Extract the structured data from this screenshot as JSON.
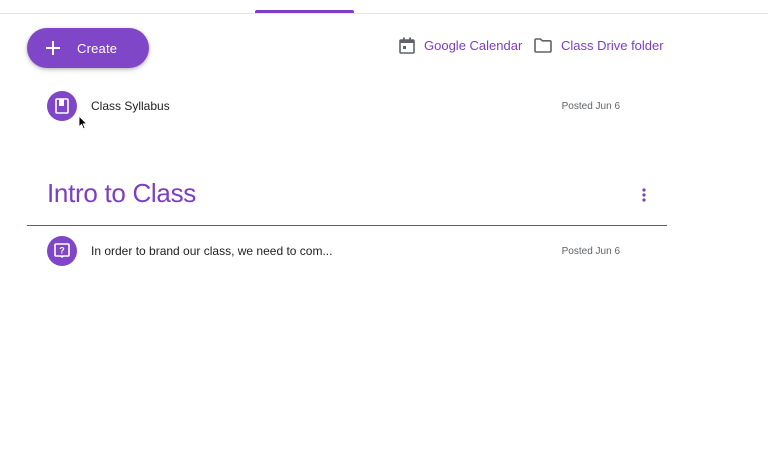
{
  "header": {
    "create_label": "Create",
    "calendar_label": "Google Calendar",
    "drive_label": "Class Drive folder"
  },
  "items": {
    "syllabus": {
      "title": "Class Syllabus",
      "posted": "Posted Jun 6",
      "icon": "material-book-icon"
    },
    "intro_item": {
      "title": "In order to brand our class, we need to com...",
      "posted": "Posted Jun 6",
      "icon": "question-icon"
    }
  },
  "topic": {
    "title": "Intro to Class"
  },
  "colors": {
    "accent": "#7b3fc4",
    "button": "#8046c8"
  }
}
